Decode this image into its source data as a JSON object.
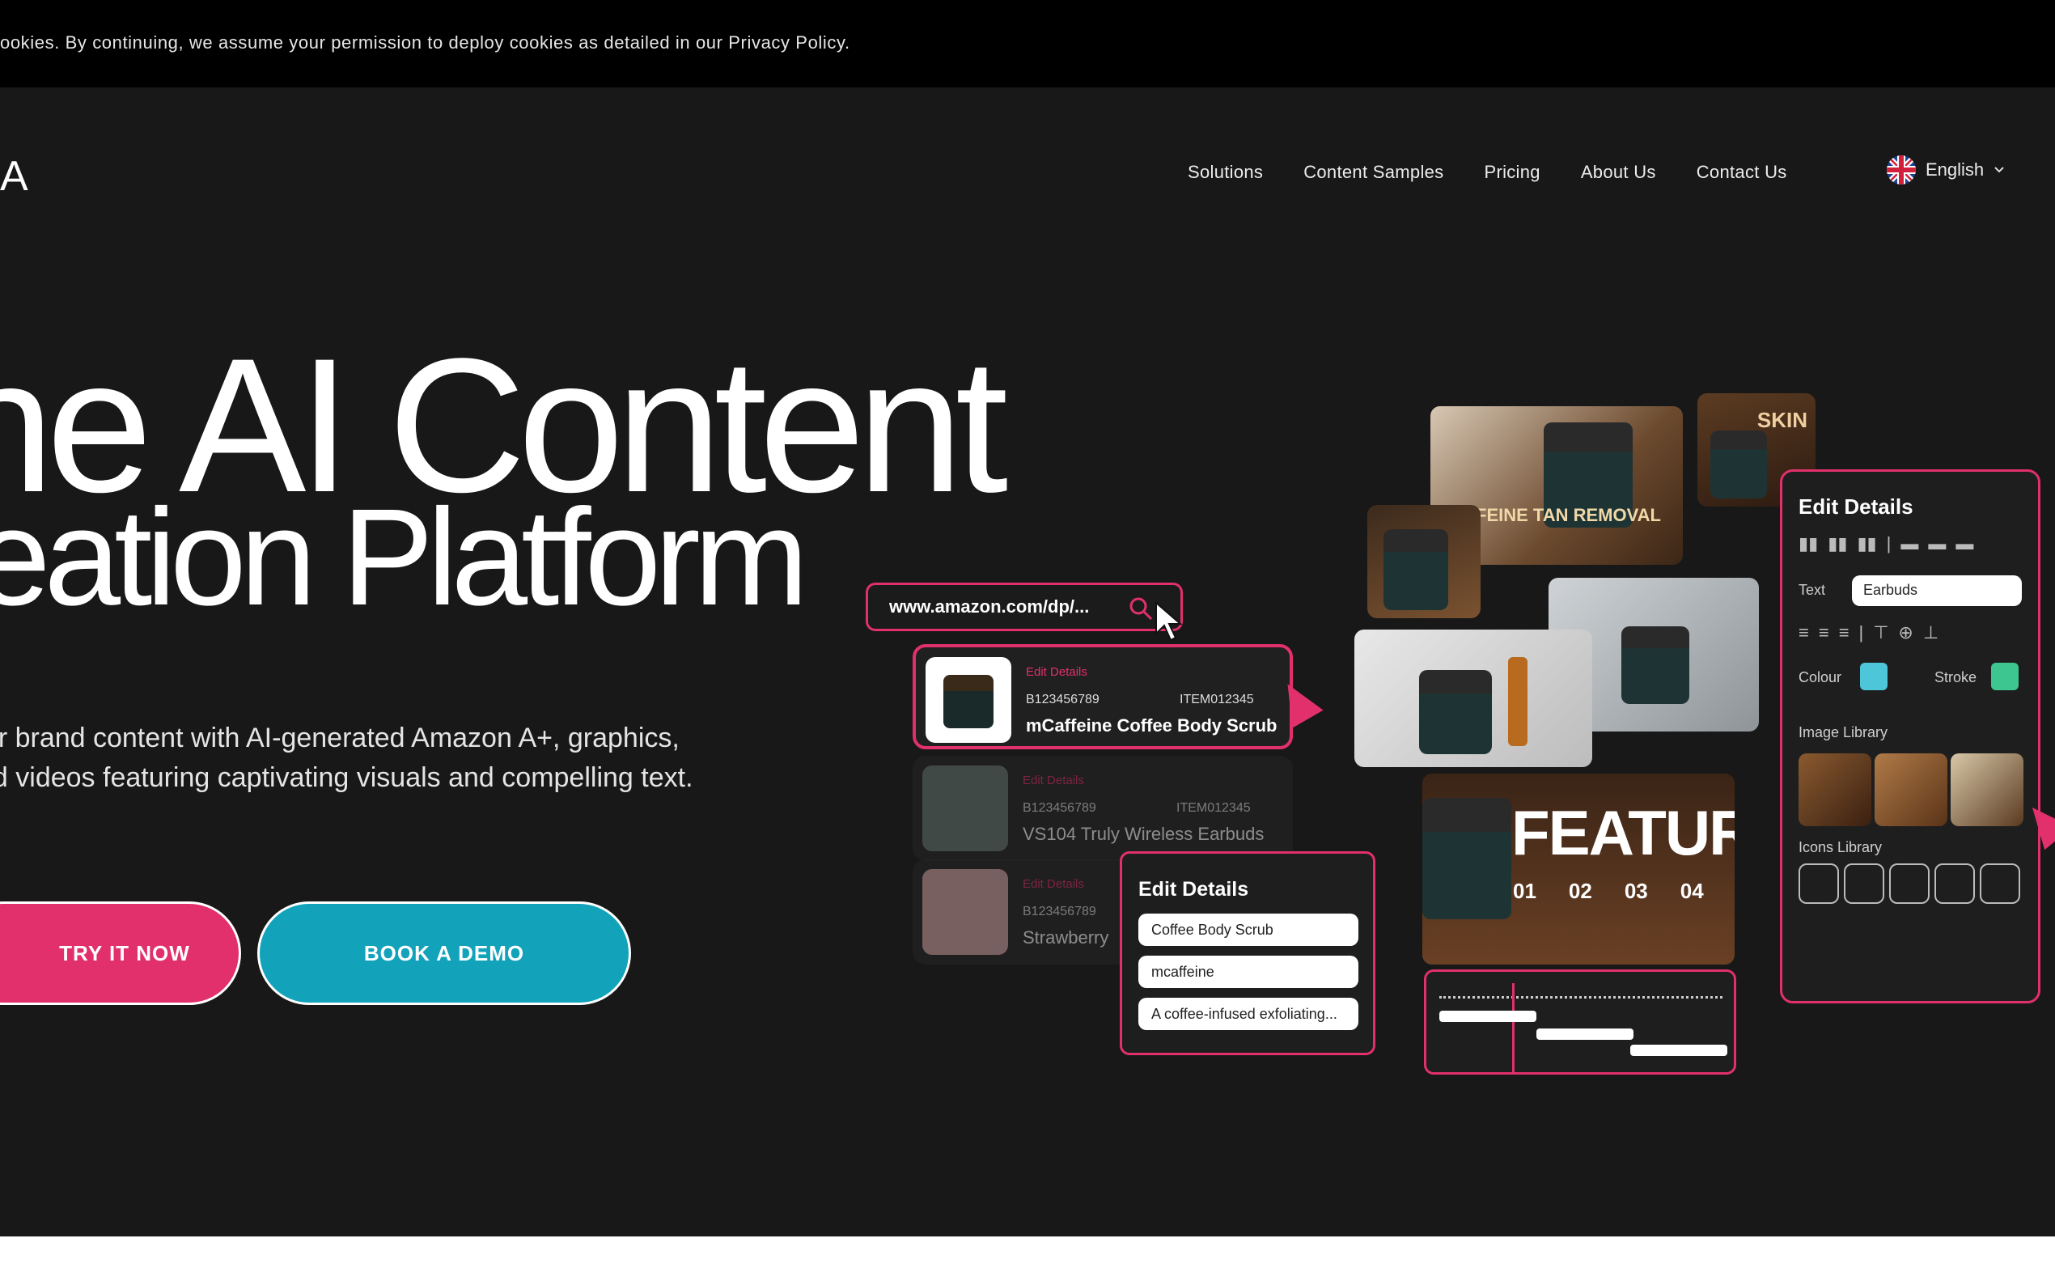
{
  "cookie_banner": {
    "text": "ookies. By continuing, we assume your permission to deploy cookies as detailed in our Privacy Policy."
  },
  "header": {
    "logo_fragment": "A",
    "nav": [
      "Solutions",
      "Content Samples",
      "Pricing",
      "About Us",
      "Contact Us"
    ],
    "language": "English"
  },
  "hero": {
    "headline_line1": "he AI Content",
    "headline_line2": "eation Platform",
    "description_line1": "our brand content with AI-generated Amazon A+, graphics,",
    "description_line2": "nd videos featuring captivating visuals and compelling text.",
    "try_button": "TRY IT NOW",
    "demo_button": "BOOK A DEMO"
  },
  "mockup": {
    "url": "www.amazon.com/dp/...",
    "cards": [
      {
        "edit": "Edit Details",
        "code": "B123456789",
        "item": "ITEM012345",
        "name": "mCaffeine Coffee Body Scrub"
      },
      {
        "edit": "Edit Details",
        "code": "B123456789",
        "item": "ITEM012345",
        "name": "VS104 Truly Wireless Earbuds"
      },
      {
        "edit": "Edit Details",
        "code": "B123456789",
        "name": "Strawberry"
      }
    ],
    "edit_panel": {
      "title": "Edit Details",
      "fields": [
        "Coffee Body Scrub",
        "mcaffeine",
        "A coffee-infused exfoliating..."
      ]
    },
    "side_panel": {
      "title": "Edit Details",
      "text_label": "Text",
      "text_value": "Earbuds",
      "colour_label": "Colour",
      "stroke_label": "Stroke",
      "image_library_label": "Image Library",
      "icons_library_label": "Icons Library"
    },
    "features_title": "FEATURES",
    "feature_numbers": [
      "01",
      "02",
      "03",
      "04"
    ],
    "skin_text": "SKIN",
    "tan_text": "FEINE TAN REMOVAL",
    "colors": {
      "accent_pink": "#e1306c",
      "accent_teal": "#12a3bb"
    }
  }
}
